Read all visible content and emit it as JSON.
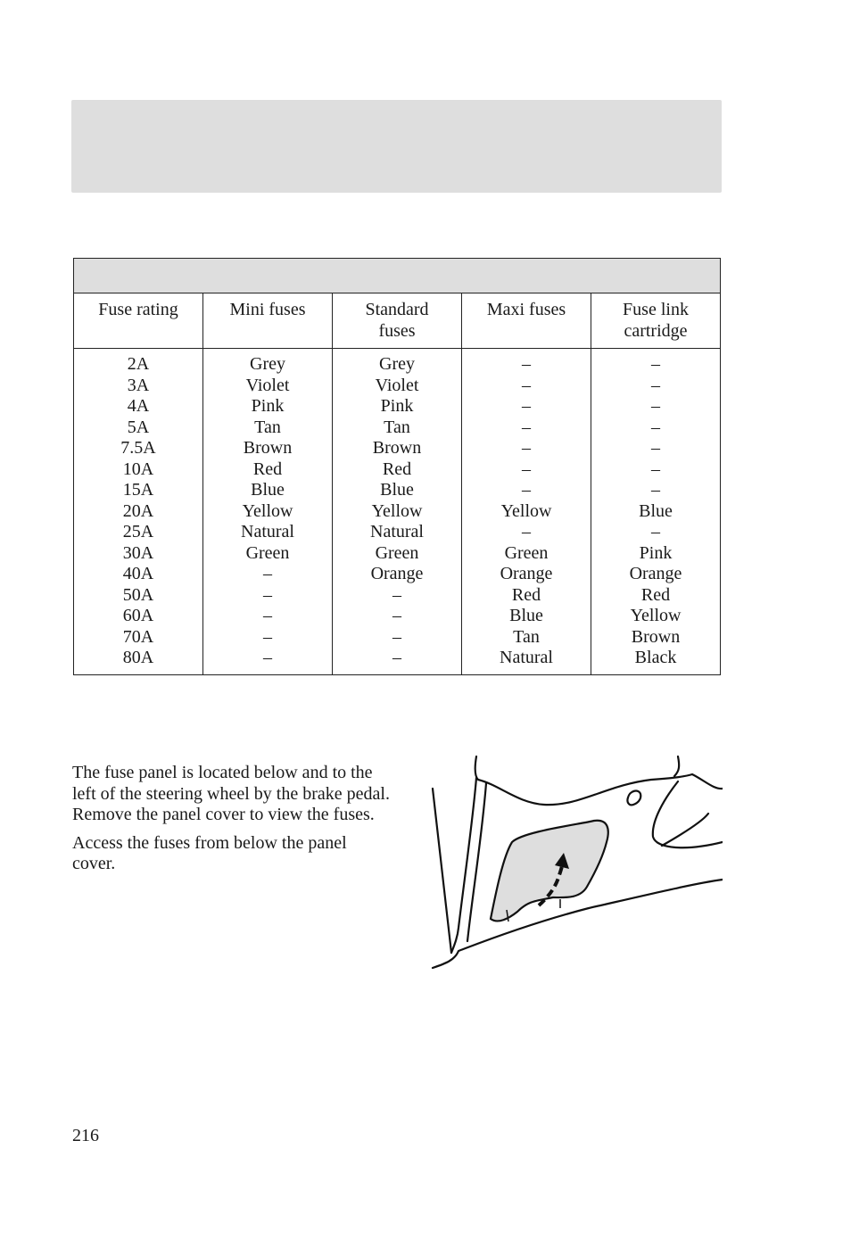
{
  "header_band": {
    "title": ""
  },
  "fuse_table": {
    "title": "",
    "columns": [
      "Fuse rating",
      "Mini fuses",
      "Standard fuses",
      "Maxi fuses",
      "Fuse link cartridge"
    ],
    "column_lines": [
      [
        "Fuse rating"
      ],
      [
        "Mini fuses"
      ],
      [
        "Standard",
        "fuses"
      ],
      [
        "Maxi fuses"
      ],
      [
        "Fuse link",
        "cartridge"
      ]
    ],
    "rows": [
      [
        "2A",
        "Grey",
        "Grey",
        "–",
        "–"
      ],
      [
        "3A",
        "Violet",
        "Violet",
        "–",
        "–"
      ],
      [
        "4A",
        "Pink",
        "Pink",
        "–",
        "–"
      ],
      [
        "5A",
        "Tan",
        "Tan",
        "–",
        "–"
      ],
      [
        "7.5A",
        "Brown",
        "Brown",
        "–",
        "–"
      ],
      [
        "10A",
        "Red",
        "Red",
        "–",
        "–"
      ],
      [
        "15A",
        "Blue",
        "Blue",
        "–",
        "–"
      ],
      [
        "20A",
        "Yellow",
        "Yellow",
        "Yellow",
        "Blue"
      ],
      [
        "25A",
        "Natural",
        "Natural",
        "–",
        "–"
      ],
      [
        "30A",
        "Green",
        "Green",
        "Green",
        "Pink"
      ],
      [
        "40A",
        "–",
        "Orange",
        "Orange",
        "Orange"
      ],
      [
        "50A",
        "–",
        "–",
        "Red",
        "Red"
      ],
      [
        "60A",
        "–",
        "–",
        "Blue",
        "Yellow"
      ],
      [
        "70A",
        "–",
        "–",
        "Tan",
        "Brown"
      ],
      [
        "80A",
        "–",
        "–",
        "Natural",
        "Black"
      ]
    ]
  },
  "body": {
    "paragraphs": [
      "The fuse panel is located below and to the left of the steering wheel by the brake pedal. Remove the panel cover to view the fuses.",
      "Access the fuses from below the panel cover."
    ]
  },
  "illustration": {
    "icon": "fuse-panel-cover-illustration",
    "fill_color": "#dedede"
  },
  "page_number": "216"
}
